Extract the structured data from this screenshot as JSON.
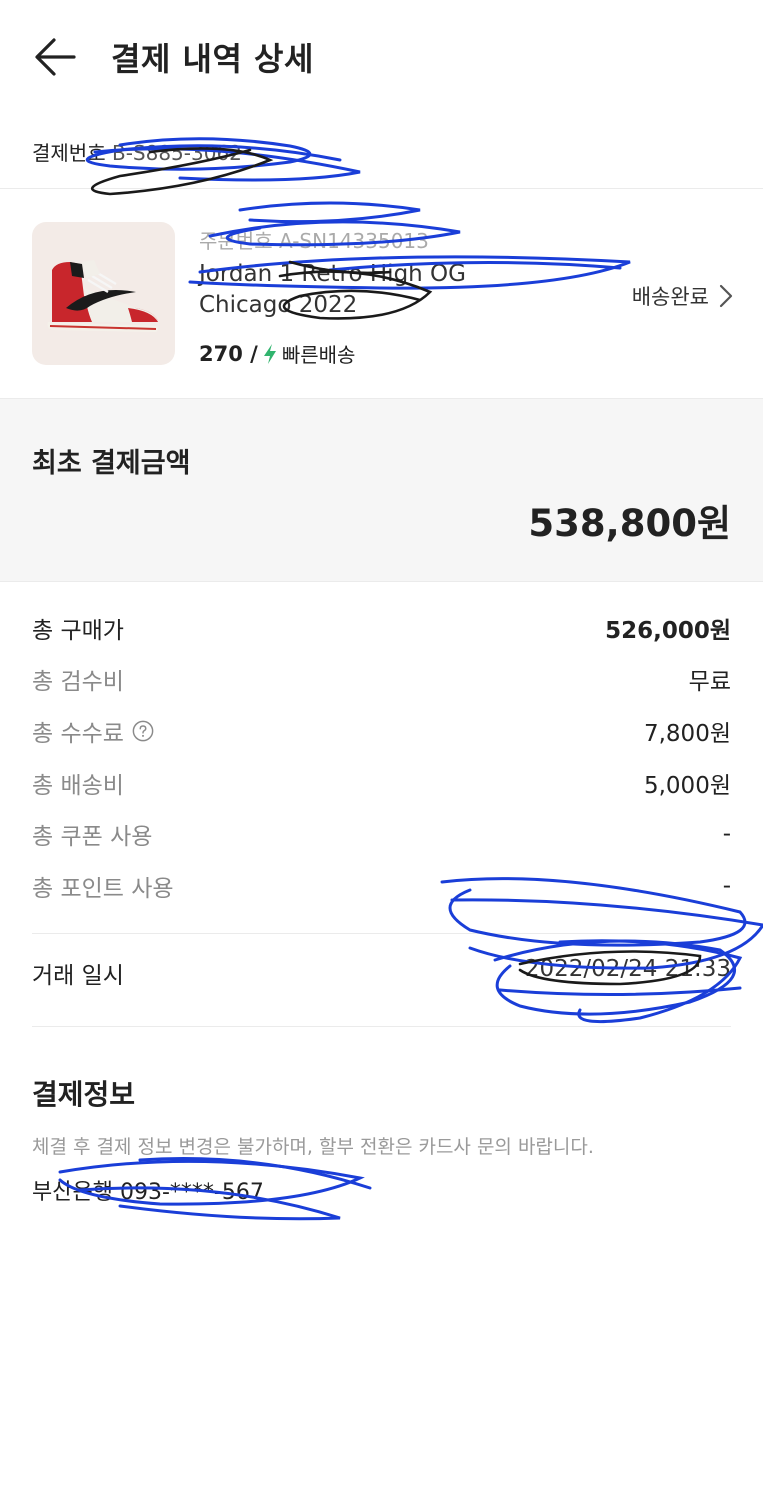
{
  "header": {
    "back_icon": "arrow-left-icon",
    "title": "결제 내역 상세"
  },
  "payment_number": {
    "label": "결제번호",
    "value": "B-S885-3062"
  },
  "product": {
    "order_number": "주문번호 A-SN14335013",
    "name": "Jordan 1 Retro High OG Chicago 2022",
    "size": "270 /",
    "fast_delivery_icon": "lightning-icon",
    "fast_delivery_label": "빠른배송",
    "status": "배송완료",
    "status_icon": "chevron-right-icon"
  },
  "total": {
    "label": "최초 결제금액",
    "value": "538,800원"
  },
  "breakdown": [
    {
      "label": "총 구매가",
      "value": "526,000원"
    },
    {
      "label": "총 검수비",
      "value": "무료"
    },
    {
      "label": "총 수수료",
      "value": "7,800원"
    },
    {
      "label": "총 배송비",
      "value": "5,000원"
    },
    {
      "label": "총 쿠폰 사용",
      "value": "-"
    },
    {
      "label": "총 포인트 사용",
      "value": "-"
    }
  ],
  "transaction": {
    "label": "거래 일시",
    "value": "2022/02/24 21:33"
  },
  "payment_info": {
    "title": "결제정보",
    "note": "체결 후 결제 정보 변경은 불가하며, 할부 전환은 카드사 문의 바랍니다.",
    "method": "부산은행 093-****-567"
  },
  "colors": {
    "accent_green": "#31b46e",
    "scribble_blue": "#1a3ed8",
    "scribble_black": "#1a1a1a",
    "panel_bg": "#f6f6f6"
  }
}
